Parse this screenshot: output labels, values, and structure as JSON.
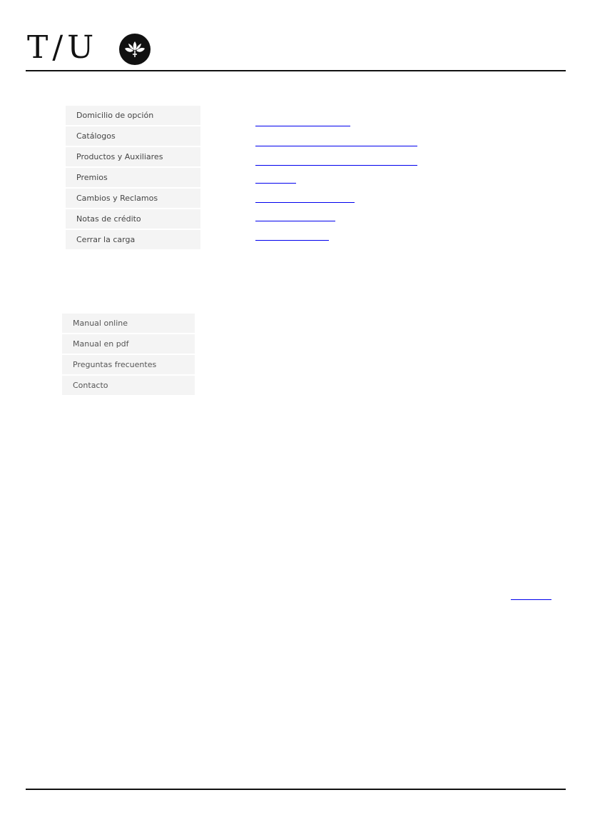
{
  "brand": {
    "logo_text": "T/U",
    "emblem_icon": "lotus-flower-icon"
  },
  "main_menu": {
    "items": [
      {
        "label": "Domicilio de opción"
      },
      {
        "label": "Catálogos"
      },
      {
        "label": "Productos y Auxiliares"
      },
      {
        "label": "Premios"
      },
      {
        "label": "Cambios y Reclamos"
      },
      {
        "label": "Notas de crédito"
      },
      {
        "label": "Cerrar la carga"
      }
    ]
  },
  "help_menu": {
    "items": [
      {
        "label": "Manual online"
      },
      {
        "label": "Manual en pdf"
      },
      {
        "label": "Preguntas frecuentes"
      },
      {
        "label": "Contacto"
      }
    ]
  },
  "colors": {
    "link": "#0000ee",
    "menu_bg": "#f4f4f4",
    "rule": "#111111"
  }
}
